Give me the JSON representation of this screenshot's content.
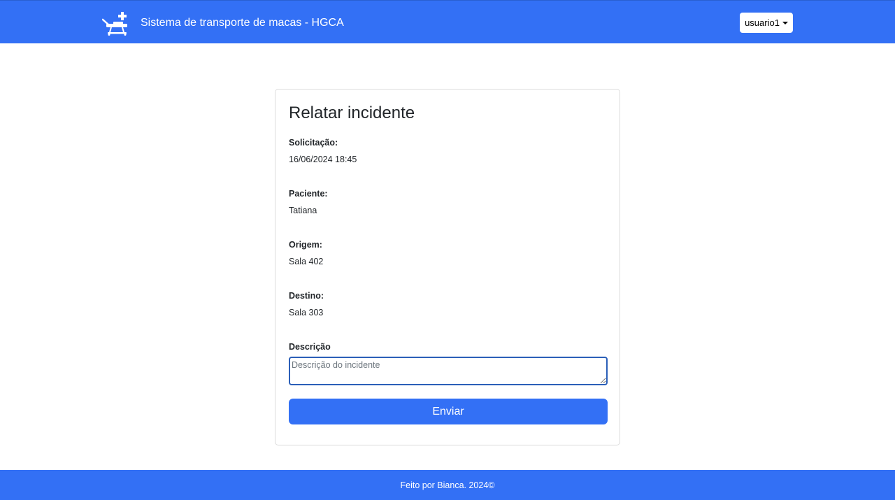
{
  "colors": {
    "primary": "#3370f5",
    "text": "#212529",
    "card_border": "#dcdcdc",
    "focus_border": "#2b5fb8"
  },
  "navbar": {
    "logo_icon": "stretcher-plus-icon",
    "title": "Sistema de transporte de macas - HGCA",
    "user_menu_label": "usuario1",
    "user_menu_icon": "caret-down-icon"
  },
  "card": {
    "title": "Relatar incidente",
    "fields": [
      {
        "label": "Solicitação:",
        "value": "16/06/2024 18:45"
      },
      {
        "label": "Paciente:",
        "value": "Tatiana"
      },
      {
        "label": "Origem:",
        "value": "Sala 402"
      },
      {
        "label": "Destino:",
        "value": "Sala 303"
      }
    ],
    "description": {
      "label": "Descrição",
      "placeholder": "Descrição do incidente",
      "value": ""
    },
    "submit_label": "Enviar"
  },
  "footer": {
    "text": "Feito por Bianca. 2024©"
  }
}
